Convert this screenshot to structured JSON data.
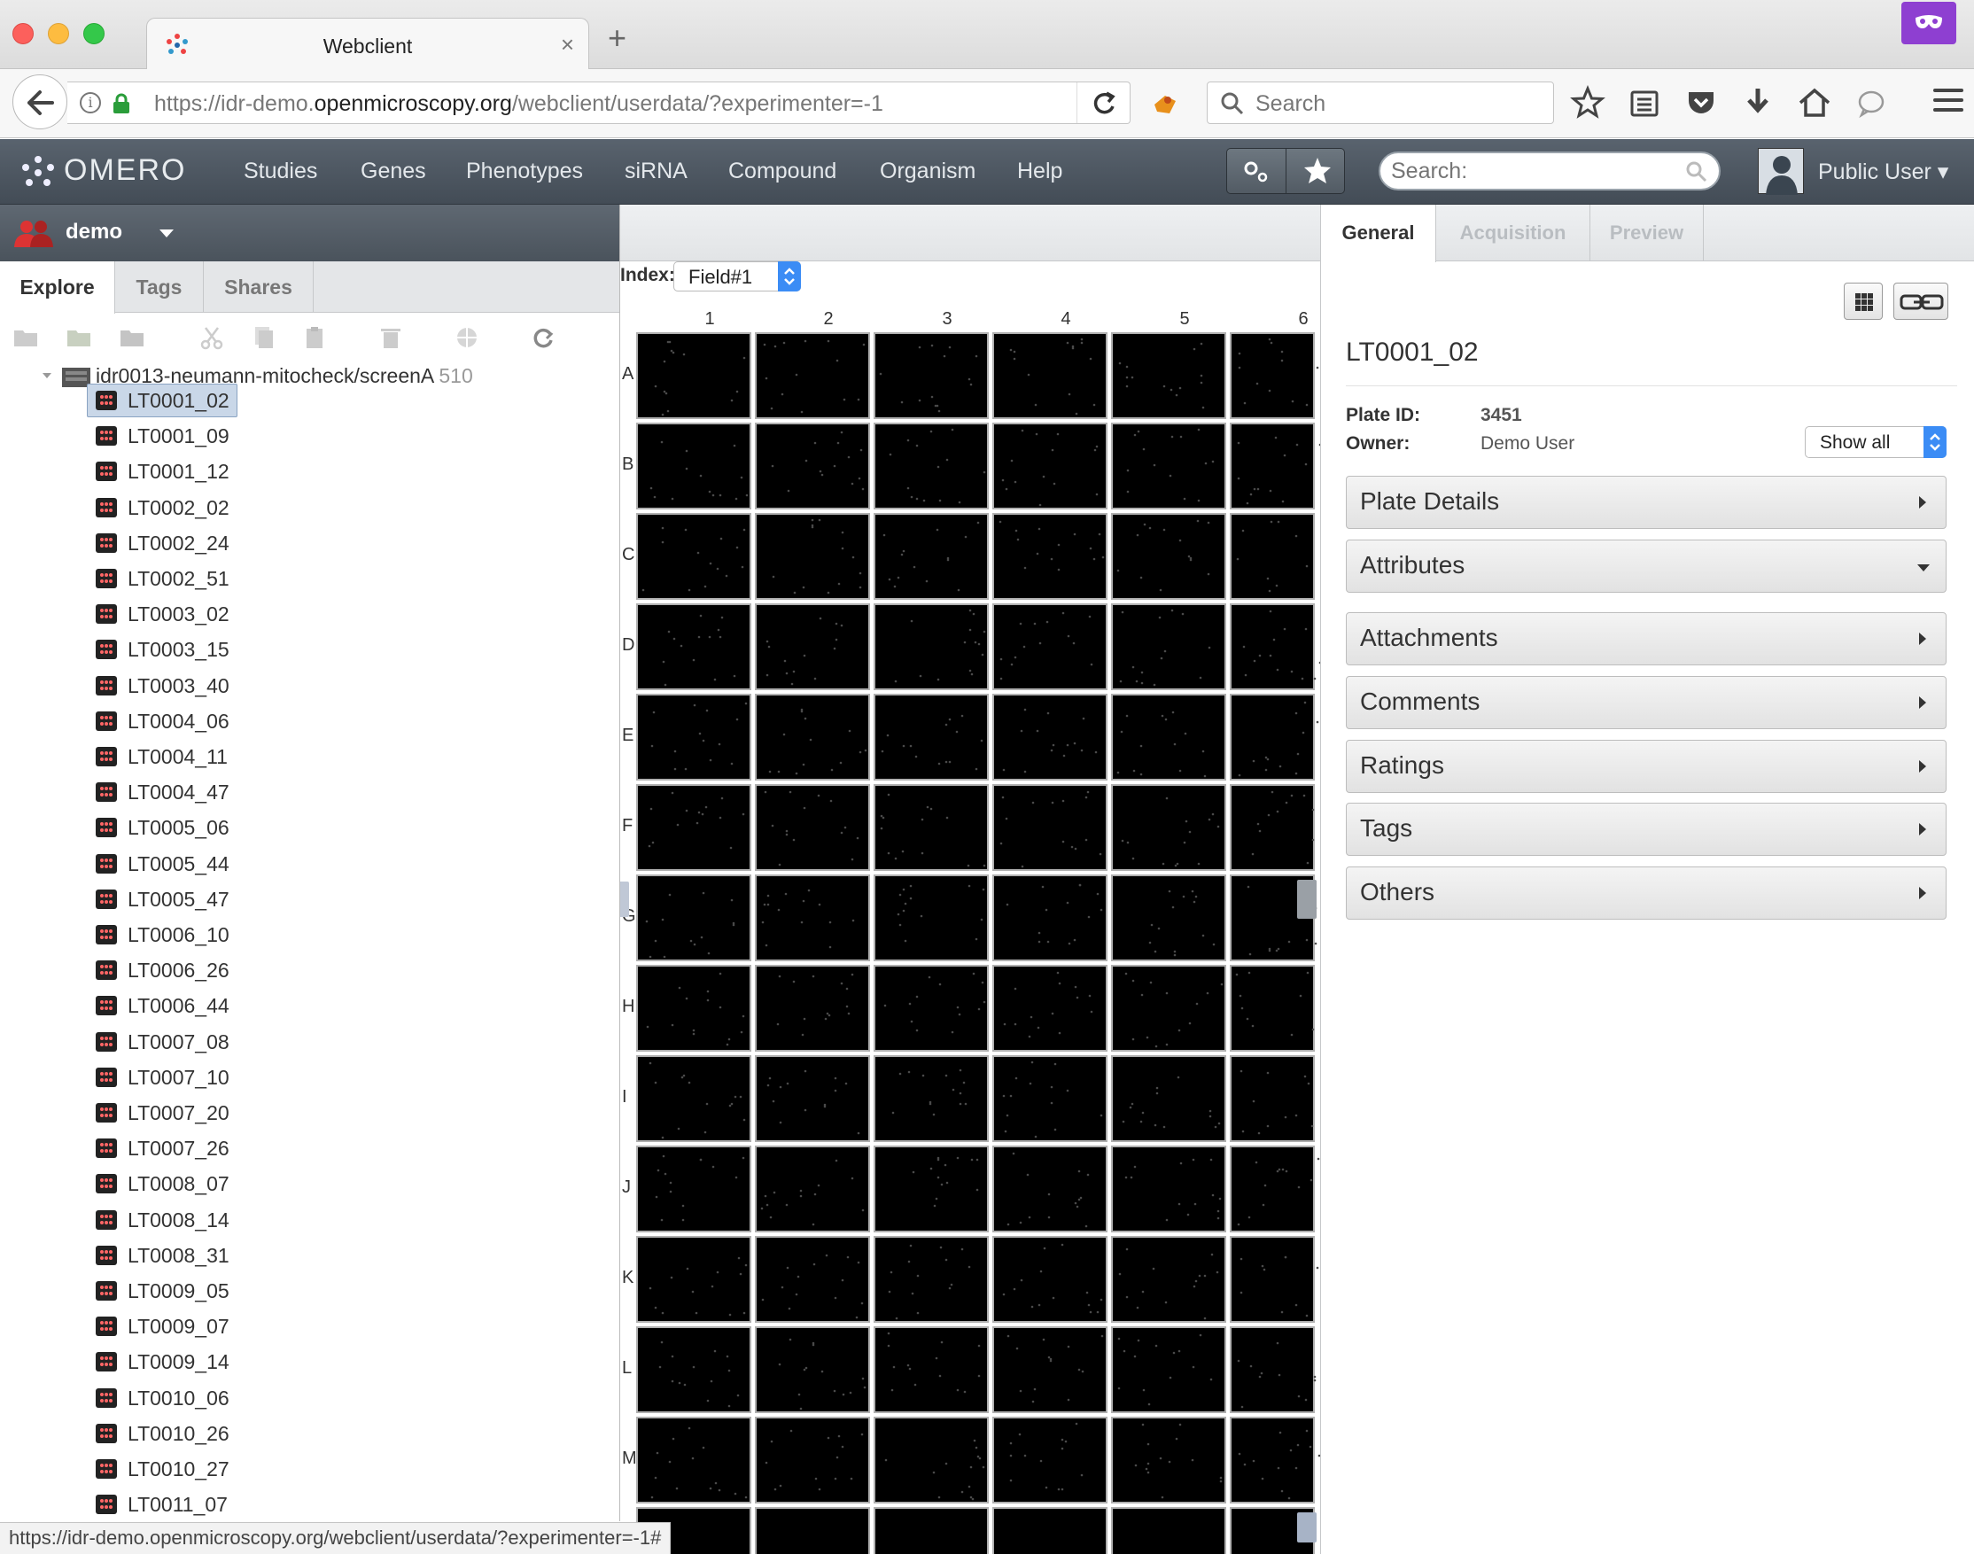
{
  "browser": {
    "tab_title": "Webclient",
    "tab_close": "×",
    "new_tab": "+",
    "url_host_prefix": "https://idr-demo.",
    "url_host": "openmicroscopy.org",
    "url_path": "/webclient/userdata/?experimenter=-1",
    "search_placeholder": "Search",
    "status_url": "https://idr-demo.openmicroscopy.org/webclient/userdata/?experimenter=-1#"
  },
  "header": {
    "logo": "OMERO",
    "nav": [
      "Studies",
      "Genes",
      "Phenotypes",
      "siRNA",
      "Compound",
      "Organism",
      "Help"
    ],
    "search_placeholder": "Search:",
    "user": "Public User"
  },
  "left": {
    "group": "demo",
    "tabs": [
      "Explore",
      "Tags",
      "Shares"
    ],
    "root": {
      "label": "idr0013-neumann-mitocheck/screenA",
      "count": "510"
    },
    "plates": [
      "LT0001_02",
      "LT0001_09",
      "LT0001_12",
      "LT0002_02",
      "LT0002_24",
      "LT0002_51",
      "LT0003_02",
      "LT0003_15",
      "LT0003_40",
      "LT0004_06",
      "LT0004_11",
      "LT0004_47",
      "LT0005_06",
      "LT0005_44",
      "LT0005_47",
      "LT0006_10",
      "LT0006_26",
      "LT0006_44",
      "LT0007_08",
      "LT0007_10",
      "LT0007_20",
      "LT0007_26",
      "LT0008_07",
      "LT0008_14",
      "LT0008_31",
      "LT0009_05",
      "LT0009_07",
      "LT0009_14",
      "LT0010_06",
      "LT0010_26",
      "LT0010_27",
      "LT0011_07"
    ],
    "selected_index": 0
  },
  "center": {
    "index_label": "Index:",
    "index_value": "Field#1",
    "columns": [
      "1",
      "2",
      "3",
      "4",
      "5",
      "6"
    ],
    "rows": [
      "A",
      "B",
      "C",
      "D",
      "E",
      "F",
      "G",
      "H",
      "I",
      "J",
      "K",
      "L",
      "M"
    ]
  },
  "right": {
    "tabs": [
      "General",
      "Acquisition",
      "Preview"
    ],
    "title": "LT0001_02",
    "plate_id_label": "Plate ID:",
    "plate_id": "3451",
    "owner_label": "Owner:",
    "owner": "Demo User",
    "show_all": "Show all",
    "sections": [
      {
        "label": "Plate Details",
        "expanded": false
      },
      {
        "label": "Attributes",
        "expanded": true
      },
      {
        "label": "Attachments",
        "expanded": false
      },
      {
        "label": "Comments",
        "expanded": false
      },
      {
        "label": "Ratings",
        "expanded": false
      },
      {
        "label": "Tags",
        "expanded": false
      },
      {
        "label": "Others",
        "expanded": false
      }
    ]
  },
  "colors": {
    "header_bg": "#4c555f",
    "select_blue": "#3b8cf5",
    "selection": "#c9d7e8"
  }
}
